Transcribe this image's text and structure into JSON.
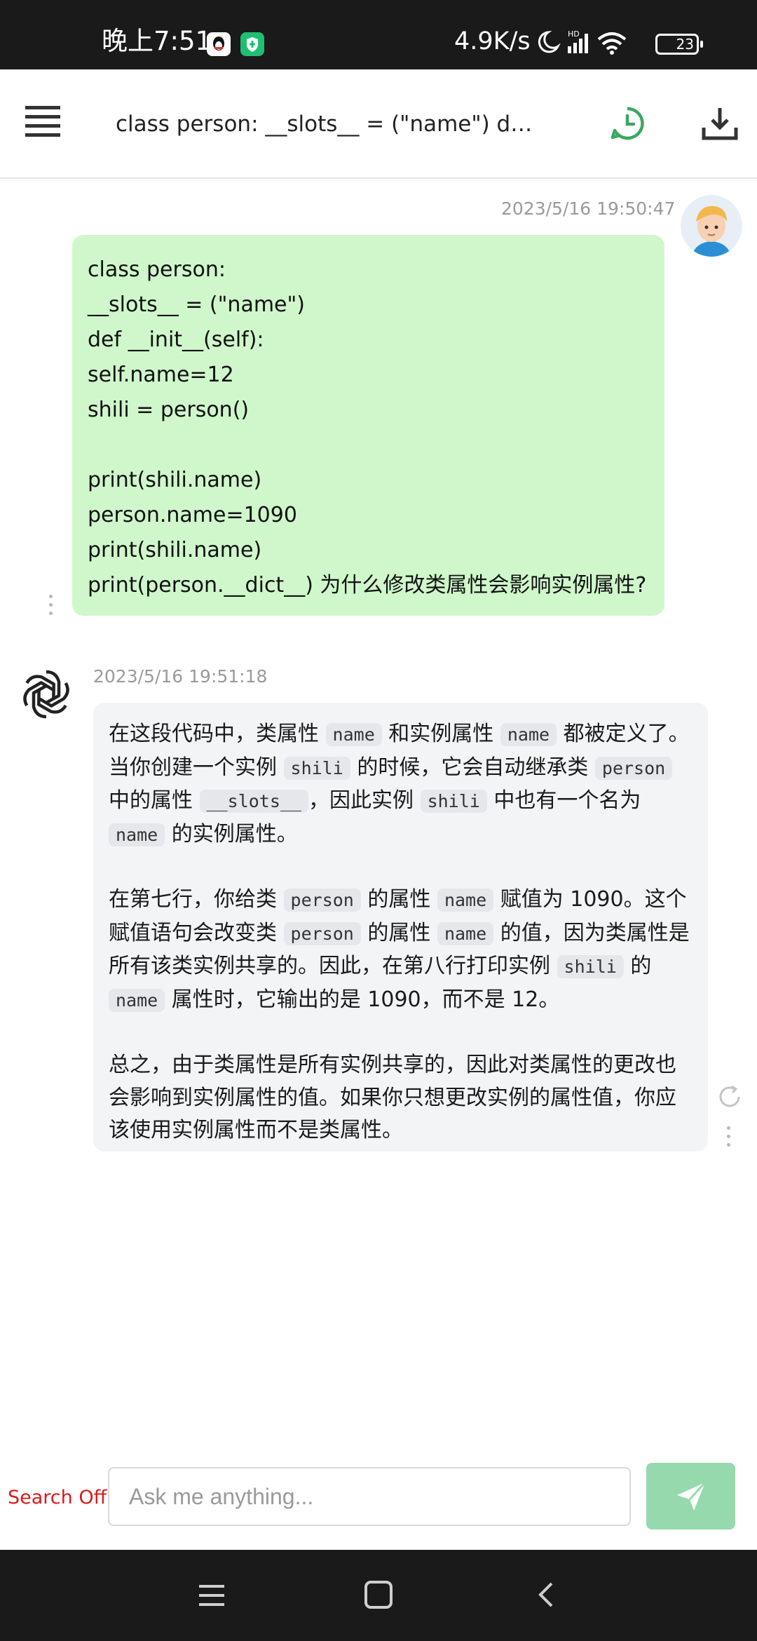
{
  "status_bar": {
    "time": "晚上7:51",
    "network_speed": "4.9K/s",
    "battery": "23",
    "icons": [
      "qq-icon",
      "shield-icon",
      "moon-icon",
      "hd-signal-icon",
      "wifi-icon",
      "battery-icon"
    ]
  },
  "header": {
    "title": "class person: __slots__ = (\"name\") def __i...",
    "icons": [
      "menu-icon",
      "history-icon",
      "download-icon"
    ],
    "history_color": "#3aa860"
  },
  "messages": {
    "user": {
      "timestamp": "2023/5/16 19:50:47",
      "lines": [
        "class person:",
        "__slots__ = (\"name\")",
        "def __init__(self):",
        "self.name=12",
        "shili = person()",
        "",
        "print(shili.name)",
        "person.name=1090",
        "print(shili.name)",
        "print(person.__dict__) 为什么修改类属性会影响实例属性?"
      ],
      "bubble_color": "#cff7cb"
    },
    "bot": {
      "timestamp": "2023/5/16 19:51:18",
      "p1": [
        "在这段代码中，类属性 ",
        "name",
        " 和实例属性 ",
        "name",
        " 都被定义了。当你创建一个实例 ",
        "shili",
        " 的时候，它会自动继承类 ",
        "person",
        " 中的属性 ",
        "__slots__",
        "，因此实例 ",
        "shili",
        " 中也有一个名为 ",
        "name",
        " 的实例属性。"
      ],
      "p2": [
        "在第七行，你给类 ",
        "person",
        " 的属性 ",
        "name",
        " 赋值为 1090。这个赋值语句会改变类 ",
        "person",
        " 的属性 ",
        "name",
        " 的值，因为类属性是所有该类实例共享的。因此，在第八行打印实例 ",
        "shili",
        " 的 ",
        "name",
        " 属性时，它输出的是 1090，而不是 12。"
      ],
      "p3": "总之，由于类属性是所有实例共享的，因此对类属性的更改也会影响到实例属性的值。如果你只想更改实例的属性值，你应该使用实例属性而不是类属性。",
      "bubble_color": "#f3f4f6"
    }
  },
  "input_bar": {
    "search_toggle": "Search Off",
    "placeholder": "Ask me anything...",
    "value": "",
    "send_color": "#95d9ad",
    "toggle_color": "#d81b1b"
  },
  "nav_bar": {
    "icons": [
      "recents-icon",
      "home-icon",
      "back-icon"
    ]
  }
}
